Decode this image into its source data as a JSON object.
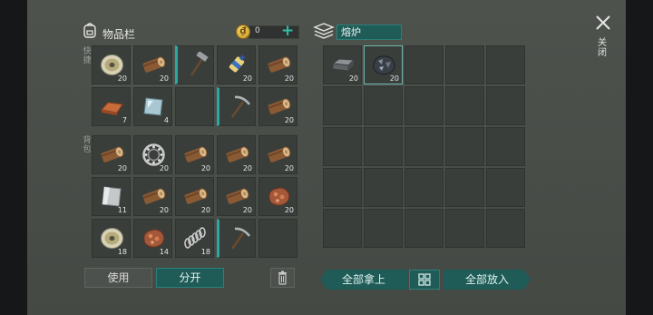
{
  "inventory": {
    "title": "物品栏",
    "coins": "0",
    "coin_symbol": "₫",
    "add_label": "+",
    "quick_label": "快捷",
    "backpack_label": "背包",
    "quick_slots": [
      {
        "icon": "cable-spool-icon",
        "qty": "20"
      },
      {
        "icon": "wood-log-icon",
        "qty": "20"
      },
      {
        "icon": "hammer-icon",
        "qty": "",
        "bar": true
      },
      {
        "icon": "glue-tube-icon",
        "qty": "20"
      },
      {
        "icon": "wood-log-icon",
        "qty": "20"
      },
      {
        "icon": "copper-ingot-icon",
        "qty": "7"
      },
      {
        "icon": "glass-pane-icon",
        "qty": "4"
      },
      {
        "icon": "",
        "qty": ""
      },
      {
        "icon": "pickaxe-icon",
        "qty": "",
        "bar": true
      },
      {
        "icon": "wood-log-icon",
        "qty": "20"
      }
    ],
    "backpack_slots": [
      {
        "icon": "wood-log-icon",
        "qty": "20"
      },
      {
        "icon": "bearing-icon",
        "qty": "20"
      },
      {
        "icon": "wood-log-icon",
        "qty": "20"
      },
      {
        "icon": "wood-log-icon",
        "qty": "20"
      },
      {
        "icon": "wood-log-icon",
        "qty": "20"
      },
      {
        "icon": "metal-plate-icon",
        "qty": "11"
      },
      {
        "icon": "wood-log-icon",
        "qty": "20"
      },
      {
        "icon": "wood-log-icon",
        "qty": "20"
      },
      {
        "icon": "wood-log-icon",
        "qty": "20"
      },
      {
        "icon": "copper-ore-icon",
        "qty": "20"
      },
      {
        "icon": "cable-spool-icon",
        "qty": "18"
      },
      {
        "icon": "copper-ore-icon",
        "qty": "14"
      },
      {
        "icon": "spring-icon",
        "qty": "18"
      },
      {
        "icon": "pickaxe-icon",
        "qty": "",
        "bar": true
      },
      {
        "icon": "",
        "qty": ""
      }
    ],
    "use_label": "使用",
    "split_label": "分开"
  },
  "furnace": {
    "title": "熔炉",
    "slots": [
      {
        "icon": "iron-ingot-icon",
        "qty": "20"
      },
      {
        "icon": "iron-ore-icon",
        "qty": "20",
        "selected": true
      }
    ],
    "take_all_label": "全部拿上",
    "put_all_label": "全部放入"
  },
  "close_label": "关闭",
  "colors": {
    "accent": "#1f5b57",
    "accent_border": "#2c807a",
    "plus": "#2fc0a9"
  }
}
